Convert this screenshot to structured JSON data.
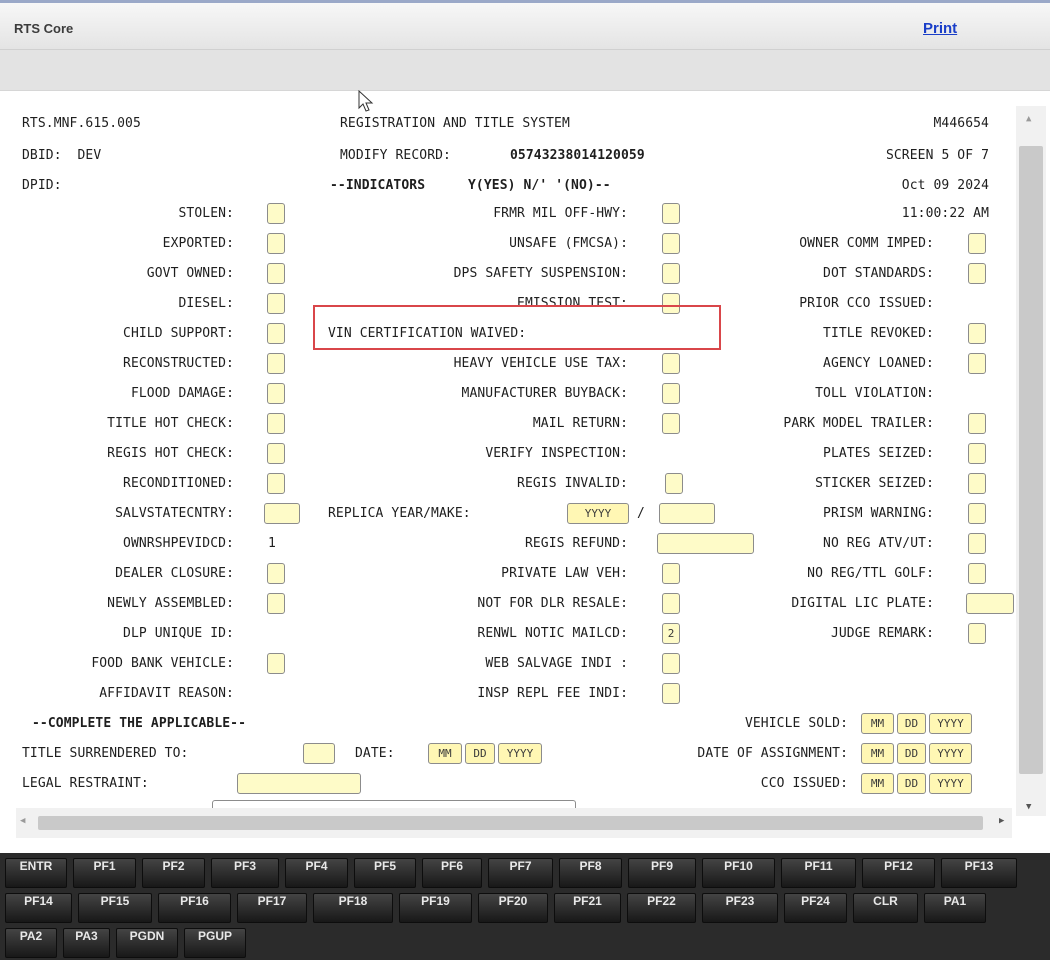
{
  "header": {
    "app_title": "RTS Core",
    "print_label": "Print"
  },
  "screen": {
    "program_id": "RTS.MNF.615.005",
    "system_title": "REGISTRATION AND TITLE SYSTEM",
    "user_id": "M446654",
    "dbid": "DBID:  DEV",
    "modify_label": "MODIFY RECORD:",
    "record_number": "05743238014120059",
    "screen_no": "SCREEN 5 OF 7",
    "dpid": "DPID:",
    "indicators_title": "--INDICATORS",
    "indicators_legend": "Y(YES) N/' '(NO)--",
    "date": "Oct 09 2024",
    "time": "11:00:22 AM",
    "col1": [
      {
        "label": "STOLEN:",
        "value": ""
      },
      {
        "label": "EXPORTED:",
        "value": ""
      },
      {
        "label": "GOVT OWNED:",
        "value": ""
      },
      {
        "label": "DIESEL:",
        "value": ""
      },
      {
        "label": "CHILD SUPPORT:",
        "value": ""
      },
      {
        "label": "RECONSTRUCTED:",
        "value": ""
      },
      {
        "label": "FLOOD DAMAGE:",
        "value": ""
      },
      {
        "label": "TITLE HOT CHECK:",
        "value": ""
      },
      {
        "label": "REGIS HOT CHECK:",
        "value": ""
      },
      {
        "label": "RECONDITIONED:",
        "value": ""
      },
      {
        "label": "SALVSTATECNTRY:",
        "value": ""
      },
      {
        "label": "OWNRSHPEVIDCD:",
        "value": "1"
      },
      {
        "label": "DEALER CLOSURE:",
        "value": ""
      },
      {
        "label": "NEWLY ASSEMBLED:",
        "value": ""
      },
      {
        "label": "DLP UNIQUE ID:",
        "value": ""
      },
      {
        "label": "FOOD BANK VEHICLE:",
        "value": ""
      },
      {
        "label": "AFFIDAVIT REASON:",
        "value": ""
      }
    ],
    "col2": [
      {
        "label": "FRMR MIL OFF-HWY:",
        "value": ""
      },
      {
        "label": "UNSAFE (FMCSA):",
        "value": ""
      },
      {
        "label": "DPS SAFETY SUSPENSION:",
        "value": ""
      },
      {
        "label": "EMISSION TEST:",
        "value": ""
      },
      {
        "label": "VIN CERTIFICATION WAIVED:",
        "value": ""
      },
      {
        "label": "HEAVY VEHICLE USE TAX:",
        "value": ""
      },
      {
        "label": "MANUFACTURER BUYBACK:",
        "value": ""
      },
      {
        "label": "MAIL RETURN:",
        "value": ""
      },
      {
        "label": "VERIFY INSPECTION:",
        "value": ""
      },
      {
        "label": "REGIS INVALID:",
        "value": ""
      },
      {
        "label": "REPLICA YEAR/MAKE:",
        "value": "YYYY"
      },
      {
        "label": "REGIS REFUND:",
        "value": ""
      },
      {
        "label": "PRIVATE LAW VEH:",
        "value": ""
      },
      {
        "label": "NOT FOR DLR RESALE:",
        "value": ""
      },
      {
        "label": "RENWL NOTIC MAILCD:",
        "value": "2"
      },
      {
        "label": "WEB SALVAGE INDI :",
        "value": ""
      },
      {
        "label": "INSP REPL FEE INDI:",
        "value": ""
      }
    ],
    "replica_slash": "/",
    "col3": [
      {
        "label": "OWNER COMM IMPED:",
        "value": ""
      },
      {
        "label": "DOT STANDARDS:",
        "value": ""
      },
      {
        "label": "PRIOR CCO ISSUED:",
        "value": ""
      },
      {
        "label": "TITLE REVOKED:",
        "value": ""
      },
      {
        "label": "AGENCY LOANED:",
        "value": ""
      },
      {
        "label": "TOLL VIOLATION:",
        "value": ""
      },
      {
        "label": "PARK MODEL TRAILER:",
        "value": ""
      },
      {
        "label": "PLATES SEIZED:",
        "value": ""
      },
      {
        "label": "STICKER SEIZED:",
        "value": ""
      },
      {
        "label": "PRISM WARNING:",
        "value": ""
      },
      {
        "label": "NO REG ATV/UT:",
        "value": ""
      },
      {
        "label": "NO REG/TTL GOLF:",
        "value": ""
      },
      {
        "label": "DIGITAL LIC PLATE:",
        "value": ""
      },
      {
        "label": "JUDGE REMARK:",
        "value": ""
      }
    ],
    "complete_title": "--COMPLETE THE APPLICABLE--",
    "vehicle_sold": "VEHICLE SOLD:",
    "title_surrendered": "TITLE SURRENDERED TO:",
    "date_label": "DATE:",
    "date_of_assignment": "DATE OF ASSIGNMENT:",
    "legal_restraint": "LEGAL RESTRAINT:",
    "cco_issued": "CCO ISSUED:",
    "mm": "MM",
    "dd": "DD",
    "yyyy": "YYYY"
  },
  "keys": [
    "ENTR",
    "PF1",
    "PF2",
    "PF3",
    "PF4",
    "PF5",
    "PF6",
    "PF7",
    "PF8",
    "PF9",
    "PF10",
    "PF11",
    "PF12",
    "PF13",
    "PF14",
    "PF15",
    "PF16",
    "PF17",
    "PF18",
    "PF19",
    "PF20",
    "PF21",
    "PF22",
    "PF23",
    "PF24",
    "CLR",
    "PA1",
    "PA2",
    "PA3",
    "PGDN",
    "PGUP"
  ]
}
